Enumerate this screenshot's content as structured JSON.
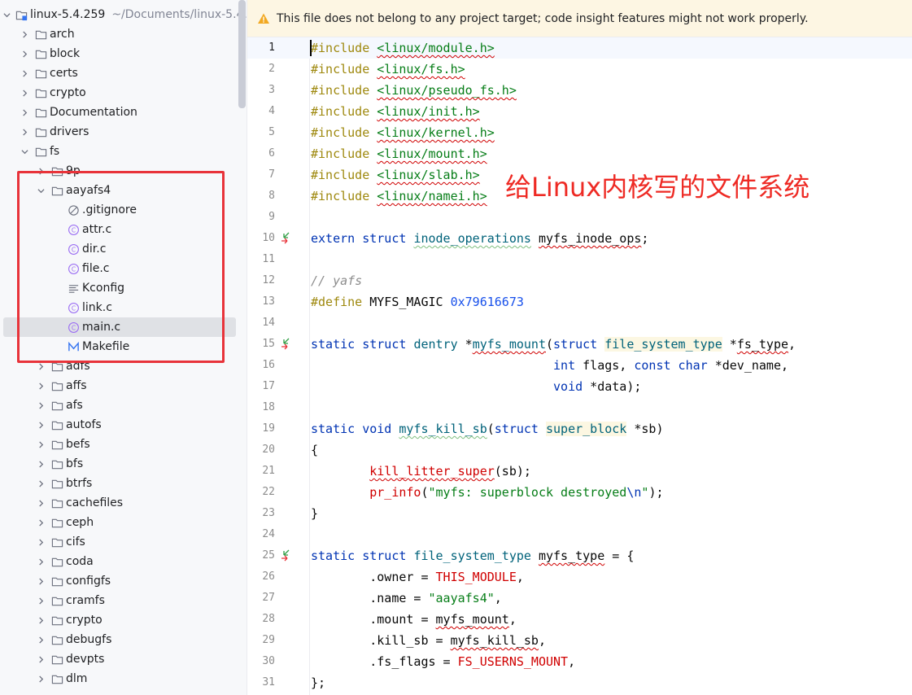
{
  "tree": {
    "root": {
      "name": "linux-5.4.259",
      "path": "~/Documents/linux-5.4..."
    },
    "items": [
      {
        "label": "arch",
        "type": "folder",
        "expanded": false,
        "depth": 1
      },
      {
        "label": "block",
        "type": "folder",
        "expanded": false,
        "depth": 1
      },
      {
        "label": "certs",
        "type": "folder",
        "expanded": false,
        "depth": 1
      },
      {
        "label": "crypto",
        "type": "folder",
        "expanded": false,
        "depth": 1
      },
      {
        "label": "Documentation",
        "type": "folder",
        "expanded": false,
        "depth": 1
      },
      {
        "label": "drivers",
        "type": "folder",
        "expanded": false,
        "depth": 1
      },
      {
        "label": "fs",
        "type": "folder",
        "expanded": true,
        "depth": 1
      },
      {
        "label": "9p",
        "type": "folder",
        "expanded": false,
        "depth": 2
      },
      {
        "label": "aayafs4",
        "type": "folder",
        "expanded": true,
        "depth": 2
      },
      {
        "label": ".gitignore",
        "type": "ignore",
        "depth": 3
      },
      {
        "label": "attr.c",
        "type": "c",
        "depth": 3
      },
      {
        "label": "dir.c",
        "type": "c",
        "depth": 3
      },
      {
        "label": "file.c",
        "type": "c",
        "depth": 3
      },
      {
        "label": "Kconfig",
        "type": "text",
        "depth": 3
      },
      {
        "label": "link.c",
        "type": "c",
        "depth": 3
      },
      {
        "label": "main.c",
        "type": "c",
        "depth": 3,
        "selected": true
      },
      {
        "label": "Makefile",
        "type": "make",
        "depth": 3
      },
      {
        "label": "adfs",
        "type": "folder",
        "expanded": false,
        "depth": 2
      },
      {
        "label": "affs",
        "type": "folder",
        "expanded": false,
        "depth": 2
      },
      {
        "label": "afs",
        "type": "folder",
        "expanded": false,
        "depth": 2
      },
      {
        "label": "autofs",
        "type": "folder",
        "expanded": false,
        "depth": 2
      },
      {
        "label": "befs",
        "type": "folder",
        "expanded": false,
        "depth": 2
      },
      {
        "label": "bfs",
        "type": "folder",
        "expanded": false,
        "depth": 2
      },
      {
        "label": "btrfs",
        "type": "folder",
        "expanded": false,
        "depth": 2
      },
      {
        "label": "cachefiles",
        "type": "folder",
        "expanded": false,
        "depth": 2
      },
      {
        "label": "ceph",
        "type": "folder",
        "expanded": false,
        "depth": 2
      },
      {
        "label": "cifs",
        "type": "folder",
        "expanded": false,
        "depth": 2
      },
      {
        "label": "coda",
        "type": "folder",
        "expanded": false,
        "depth": 2
      },
      {
        "label": "configfs",
        "type": "folder",
        "expanded": false,
        "depth": 2
      },
      {
        "label": "cramfs",
        "type": "folder",
        "expanded": false,
        "depth": 2
      },
      {
        "label": "crypto",
        "type": "folder",
        "expanded": false,
        "depth": 2
      },
      {
        "label": "debugfs",
        "type": "folder",
        "expanded": false,
        "depth": 2
      },
      {
        "label": "devpts",
        "type": "folder",
        "expanded": false,
        "depth": 2
      },
      {
        "label": "dlm",
        "type": "folder",
        "expanded": false,
        "depth": 2
      }
    ]
  },
  "banner": {
    "text": "This file does not belong to any project target; code insight features might not work properly.",
    "icon": "warning-icon"
  },
  "annotation": "给Linux内核写的文件系统",
  "editor": {
    "lines": [
      "#include <linux/module.h>",
      "#include <linux/fs.h>",
      "#include <linux/pseudo_fs.h>",
      "#include <linux/init.h>",
      "#include <linux/kernel.h>",
      "#include <linux/mount.h>",
      "#include <linux/slab.h>",
      "#include <linux/namei.h>",
      "",
      "extern struct inode_operations myfs_inode_ops;",
      "",
      "// yafs",
      "#define MYFS_MAGIC 0x79616673",
      "",
      "static struct dentry *myfs_mount(struct file_system_type *fs_type,",
      "                                 int flags, const char *dev_name,",
      "                                 void *data);",
      "",
      "static void myfs_kill_sb(struct super_block *sb)",
      "{",
      "        kill_litter_super(sb);",
      "        pr_info(\"myfs: superblock destroyed\\n\");",
      "}",
      "",
      "static struct file_system_type myfs_type = {",
      "        .owner = THIS_MODULE,",
      "        .name = \"aayafs4\",",
      "        .mount = myfs_mount,",
      "        .kill_sb = myfs_kill_sb,",
      "        .fs_flags = FS_USERNS_MOUNT,",
      "};"
    ],
    "line_numbers": [
      "1",
      "2",
      "3",
      "4",
      "5",
      "6",
      "7",
      "8",
      "9",
      "10",
      "11",
      "12",
      "13",
      "14",
      "15",
      "16",
      "17",
      "18",
      "19",
      "20",
      "21",
      "22",
      "23",
      "24",
      "25",
      "26",
      "27",
      "28",
      "29",
      "30",
      "31"
    ],
    "gutter_markers": [
      10,
      15,
      25
    ]
  },
  "colors": {
    "keyword": "#0033b3",
    "preprocessor": "#9e880d",
    "string": "#067d17",
    "number": "#1750eb",
    "macro": "#d00000",
    "annotation": "#ee2a24",
    "highlight_box": "#e8333a"
  }
}
